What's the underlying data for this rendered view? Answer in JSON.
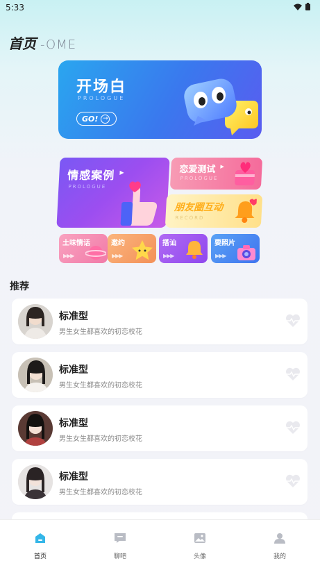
{
  "status": {
    "time": "5:33"
  },
  "header": {
    "title": "首页",
    "subtitle": "-OME"
  },
  "banner": {
    "title": "开场白",
    "subtitle": "PROLOGUE",
    "button": "GO!"
  },
  "cards": {
    "case": {
      "title": "情感案例",
      "subtitle": "PROLOGUE"
    },
    "love_test": {
      "title": "恋爱测试",
      "subtitle": "PROLOGUE"
    },
    "moments": {
      "title": "朋友圈互动",
      "subtitle": "RECORD"
    }
  },
  "shortcuts": [
    {
      "label": "土味情话",
      "color": "#f48ab0"
    },
    {
      "label": "邀约",
      "color": "#f7a86c"
    },
    {
      "label": "搭讪",
      "color": "#a45cf0"
    },
    {
      "label": "要照片",
      "color": "#4a8cf2"
    }
  ],
  "section": {
    "title": "推荐"
  },
  "items": [
    {
      "name": "标准型",
      "desc": "男生女生都喜欢的初恋校花"
    },
    {
      "name": "标准型",
      "desc": "男生女生都喜欢的初恋校花"
    },
    {
      "name": "标准型",
      "desc": "男生女生都喜欢的初恋校花"
    },
    {
      "name": "标准型",
      "desc": "男生女生都喜欢的初恋校花"
    }
  ],
  "tabbar": [
    {
      "label": "首页",
      "icon": "home-icon",
      "active": true
    },
    {
      "label": "聊吧",
      "icon": "chat-icon",
      "active": false
    },
    {
      "label": "头像",
      "icon": "image-icon",
      "active": false
    },
    {
      "label": "我的",
      "icon": "user-icon",
      "active": false
    }
  ]
}
